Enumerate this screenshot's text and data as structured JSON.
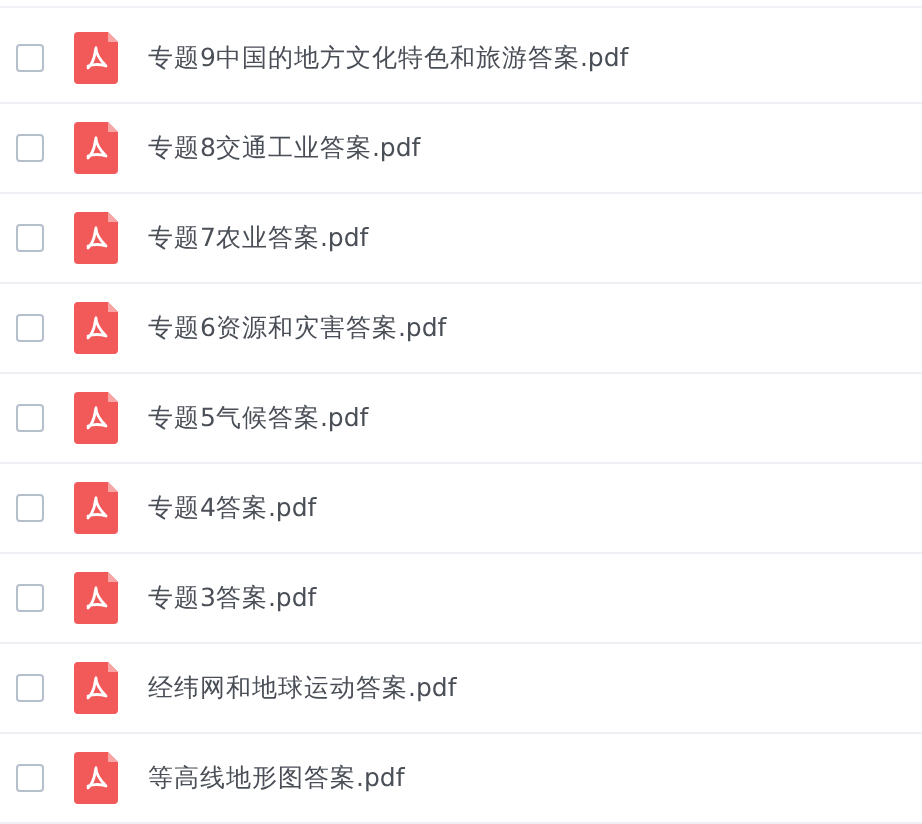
{
  "files": [
    {
      "name": "专题9中国的地方文化特色和旅游答案.pdf",
      "checked": false
    },
    {
      "name": "专题8交通工业答案.pdf",
      "checked": false
    },
    {
      "name": "专题7农业答案.pdf",
      "checked": false
    },
    {
      "name": "专题6资源和灾害答案.pdf",
      "checked": false
    },
    {
      "name": "专题5气候答案.pdf",
      "checked": false
    },
    {
      "name": "专题4答案.pdf",
      "checked": false
    },
    {
      "name": "专题3答案.pdf",
      "checked": false
    },
    {
      "name": "经纬网和地球运动答案.pdf",
      "checked": false
    },
    {
      "name": "等高线地形图答案.pdf",
      "checked": false
    }
  ]
}
